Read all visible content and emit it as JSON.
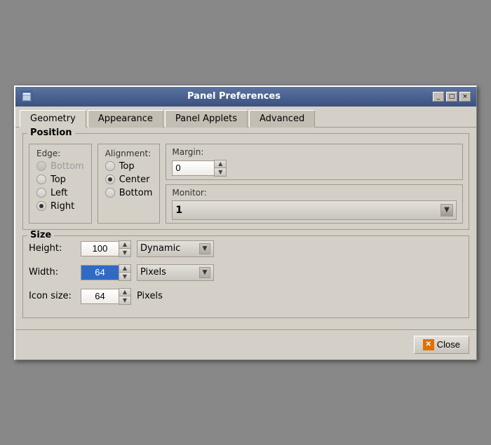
{
  "window": {
    "title": "Panel Preferences",
    "icon": "panel-icon"
  },
  "titlebar": {
    "minimize_label": "_",
    "maximize_label": "□",
    "close_label": "×"
  },
  "tabs": [
    {
      "id": "geometry",
      "label": "Geometry",
      "active": true
    },
    {
      "id": "appearance",
      "label": "Appearance",
      "active": false
    },
    {
      "id": "panel-applets",
      "label": "Panel Applets",
      "active": false
    },
    {
      "id": "advanced",
      "label": "Advanced",
      "active": false
    }
  ],
  "geometry": {
    "position_title": "Position",
    "edge_label": "Edge:",
    "edge_options": [
      {
        "label": "Bottom",
        "checked": false,
        "disabled": true
      },
      {
        "label": "Top",
        "checked": false,
        "disabled": false
      },
      {
        "label": "Left",
        "checked": false,
        "disabled": false
      },
      {
        "label": "Right",
        "checked": true,
        "disabled": false
      }
    ],
    "alignment_label": "Alignment:",
    "alignment_options": [
      {
        "label": "Top",
        "checked": false
      },
      {
        "label": "Center",
        "checked": true
      },
      {
        "label": "Bottom",
        "checked": false
      }
    ],
    "margin_label": "Margin:",
    "margin_value": "0",
    "monitor_label": "Monitor:",
    "monitor_value": "1",
    "size_title": "Size",
    "height_label": "Height:",
    "height_value": "100",
    "height_dropdown": "Dynamic",
    "width_label": "Width:",
    "width_value": "64",
    "width_dropdown": "Pixels",
    "icon_size_label": "Icon size:",
    "icon_size_value": "64",
    "icon_size_unit": "Pixels"
  },
  "footer": {
    "close_label": "Close"
  }
}
